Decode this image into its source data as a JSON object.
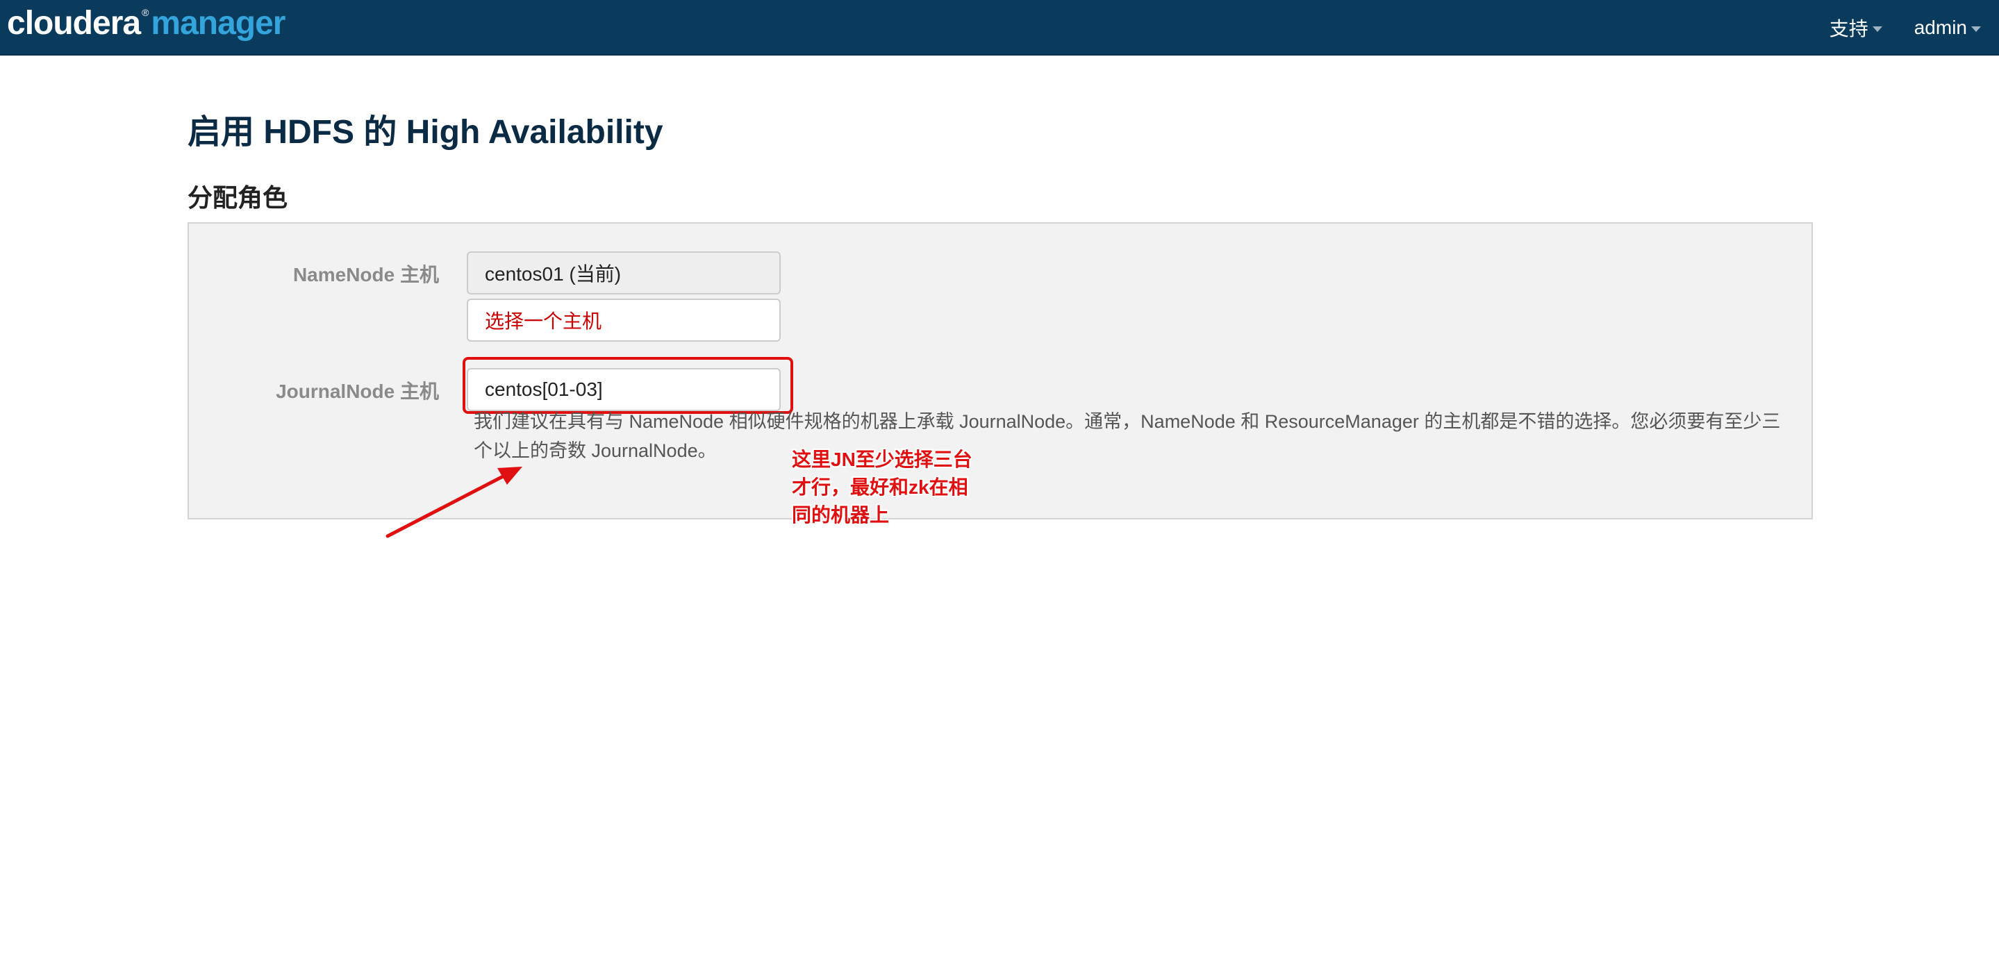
{
  "navbar": {
    "brand_part1": "cloudera",
    "brand_reg": "®",
    "brand_part2": "manager",
    "support_label": "支持",
    "user_label": "admin",
    "background_color": "#0b3b5c",
    "accent_color": "#33a5dc"
  },
  "page": {
    "title": "启用 HDFS 的 High Availability",
    "section_title": "分配角色"
  },
  "form": {
    "namenode": {
      "label": "NameNode 主机",
      "current_value": "centos01 (当前)",
      "select_placeholder": "选择一个主机"
    },
    "journalnode": {
      "label": "JournalNode 主机",
      "value": "centos[01-03]",
      "help_text": "我们建议在具有与 NameNode 相似硬件规格的机器上承载 JournalNode。通常，NameNode 和 ResourceManager 的主机都是不错的选择。您必须要有至少三个以上的奇数 JournalNode。"
    }
  },
  "annotation": {
    "line1": "这里JN至少选择三台",
    "line2": "才行，最好和zk在相",
    "line3": "同的机器上",
    "color": "#e01010"
  }
}
